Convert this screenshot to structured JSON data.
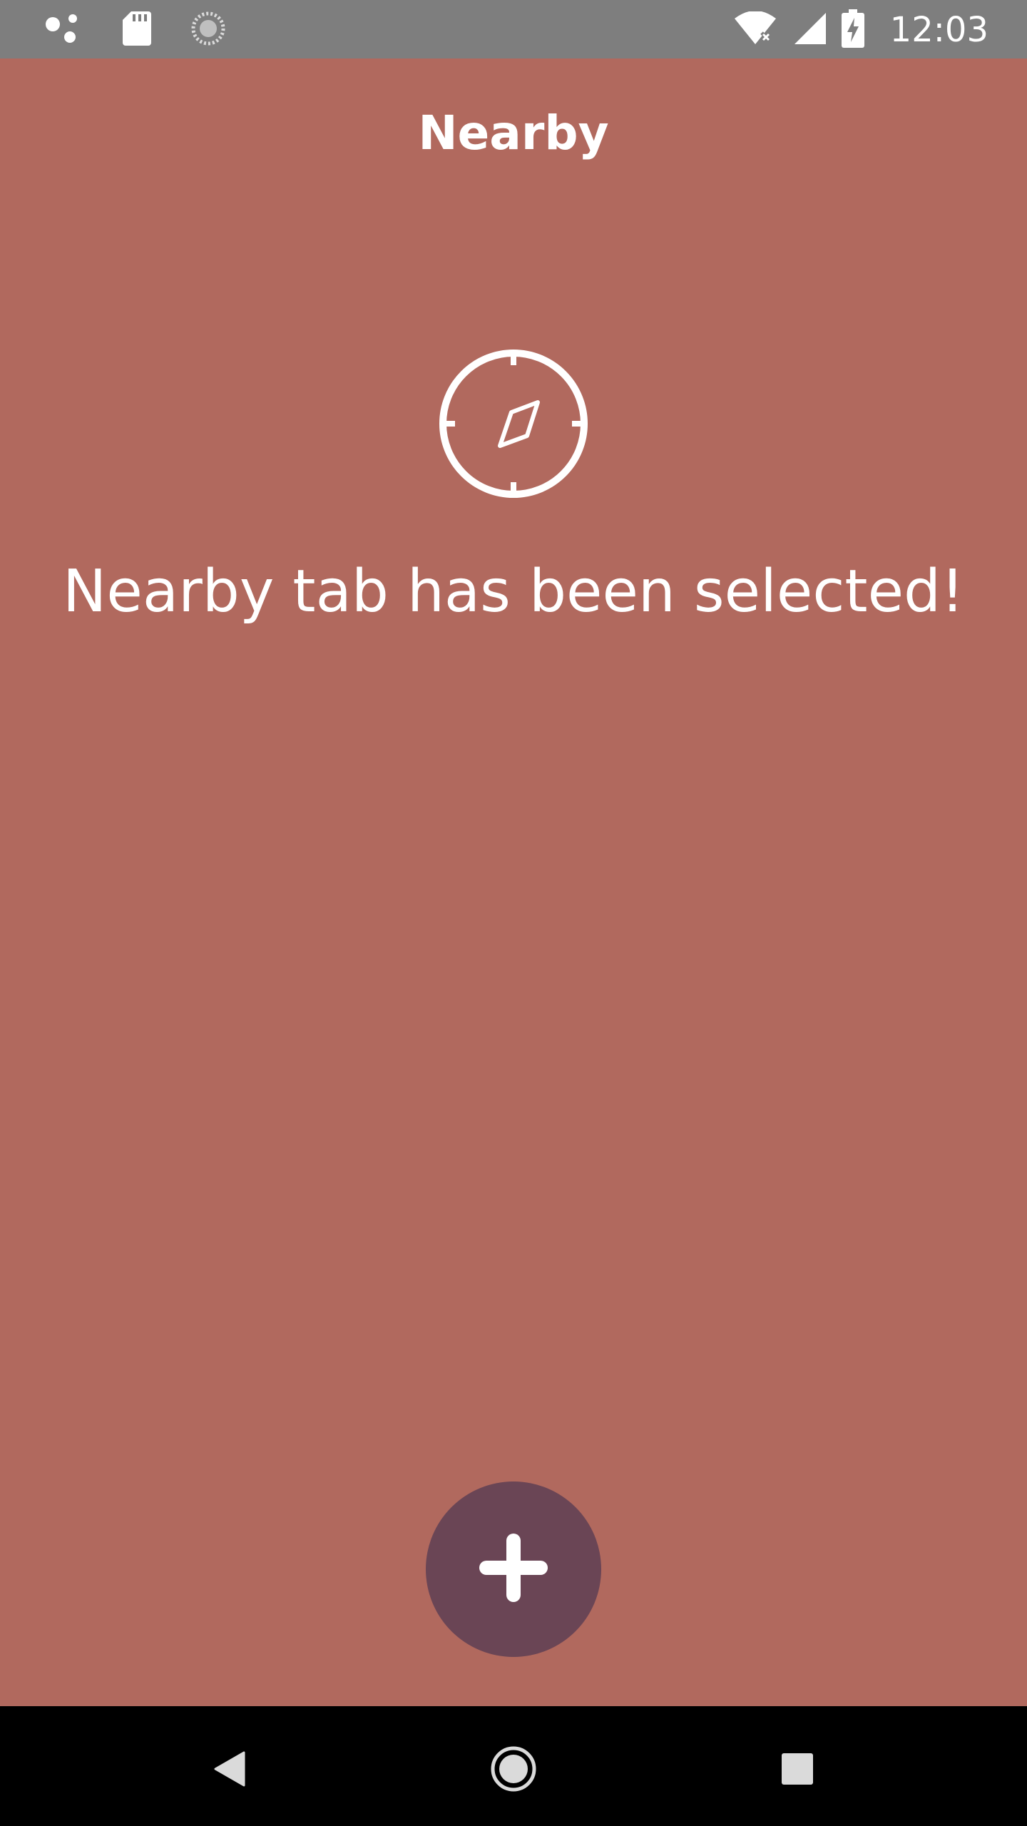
{
  "status_bar": {
    "time": "12:03",
    "icons": [
      "assistant-dots-icon",
      "sd-card-icon",
      "sync-circle-icon",
      "wifi-off-icon",
      "cell-signal-icon",
      "battery-charging-icon"
    ]
  },
  "app_bar": {
    "title": "Nearby"
  },
  "main": {
    "icon": "compass-icon",
    "message": "Nearby tab has been selected!"
  },
  "fab": {
    "icon": "plus-icon"
  },
  "navigation": {
    "buttons": [
      "back-icon",
      "home-icon",
      "recents-icon"
    ]
  },
  "colors": {
    "background": "#B1695E",
    "status_bar": "#7E7E7E",
    "fab": "#6A4555",
    "nav_bar": "#000000",
    "foreground": "#FFFFFF"
  }
}
